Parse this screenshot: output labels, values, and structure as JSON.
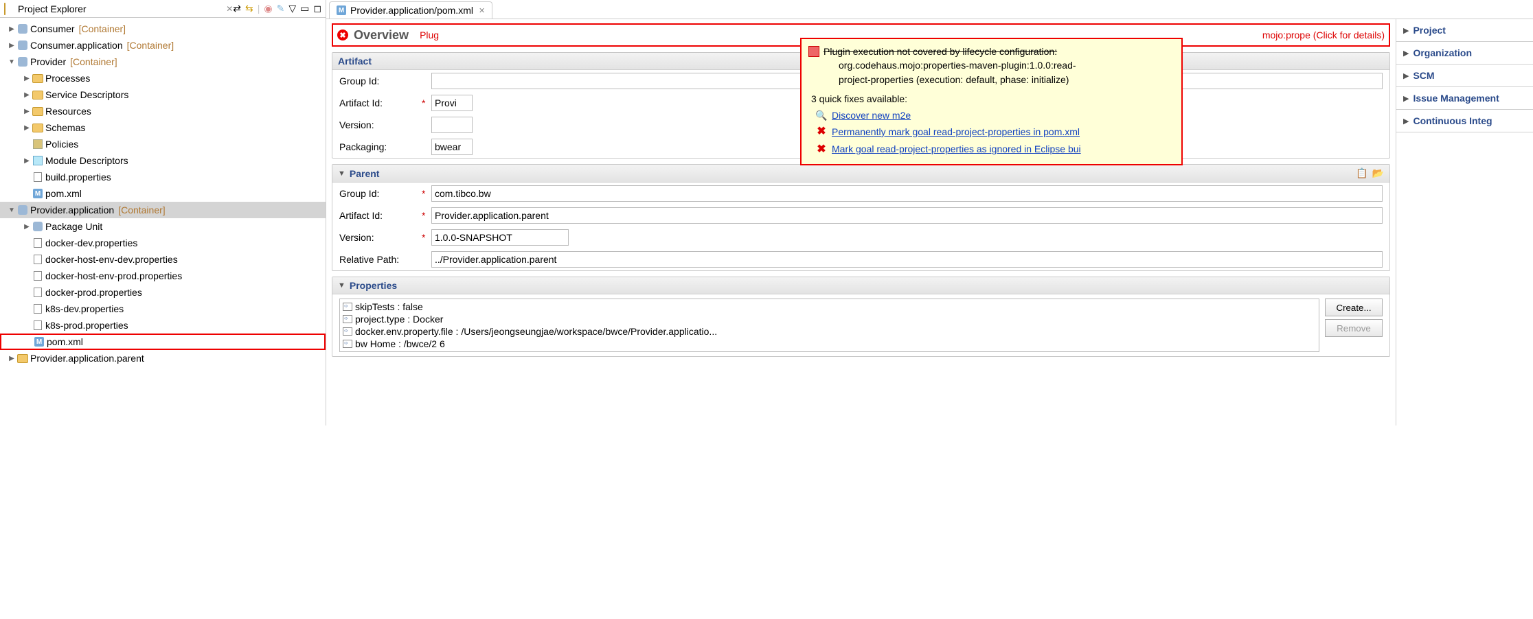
{
  "explorer": {
    "title": "Project Explorer",
    "toolbar_icons": [
      "collapse-all",
      "link-editor",
      "filter",
      "menu",
      "min",
      "max"
    ],
    "tree": [
      {
        "indent": 0,
        "arrow": "▶",
        "icon": "gear",
        "label": "Consumer",
        "suffix": "[Container]"
      },
      {
        "indent": 0,
        "arrow": "▶",
        "icon": "gear",
        "label": "Consumer.application",
        "suffix": "[Container]"
      },
      {
        "indent": 0,
        "arrow": "▼",
        "icon": "gear",
        "label": "Provider",
        "suffix": "[Container]"
      },
      {
        "indent": 1,
        "arrow": "▶",
        "icon": "folder",
        "label": "Processes"
      },
      {
        "indent": 1,
        "arrow": "▶",
        "icon": "folder",
        "label": "Service Descriptors"
      },
      {
        "indent": 1,
        "arrow": "▶",
        "icon": "folder",
        "label": "Resources"
      },
      {
        "indent": 1,
        "arrow": "▶",
        "icon": "folder",
        "label": "Schemas"
      },
      {
        "indent": 1,
        "arrow": "",
        "icon": "pkg",
        "label": "Policies"
      },
      {
        "indent": 1,
        "arrow": "▶",
        "icon": "cube",
        "label": "Module Descriptors"
      },
      {
        "indent": 1,
        "arrow": "",
        "icon": "file",
        "label": "build.properties"
      },
      {
        "indent": 1,
        "arrow": "",
        "icon": "m",
        "label": "pom.xml"
      },
      {
        "indent": 0,
        "arrow": "▼",
        "icon": "gear",
        "label": "Provider.application",
        "suffix": "[Container]",
        "selected": true
      },
      {
        "indent": 1,
        "arrow": "▶",
        "icon": "gear",
        "label": "Package Unit"
      },
      {
        "indent": 1,
        "arrow": "",
        "icon": "file",
        "label": "docker-dev.properties"
      },
      {
        "indent": 1,
        "arrow": "",
        "icon": "file",
        "label": "docker-host-env-dev.properties"
      },
      {
        "indent": 1,
        "arrow": "",
        "icon": "file",
        "label": "docker-host-env-prod.properties"
      },
      {
        "indent": 1,
        "arrow": "",
        "icon": "file",
        "label": "docker-prod.properties"
      },
      {
        "indent": 1,
        "arrow": "",
        "icon": "file",
        "label": "k8s-dev.properties"
      },
      {
        "indent": 1,
        "arrow": "",
        "icon": "file",
        "label": "k8s-prod.properties"
      },
      {
        "indent": 1,
        "arrow": "",
        "icon": "m",
        "label": "pom.xml",
        "redbox": true
      },
      {
        "indent": 0,
        "arrow": "▶",
        "icon": "folder",
        "label": "Provider.application.parent"
      }
    ]
  },
  "editor": {
    "tab_title": "Provider.application/pom.xml",
    "overview": {
      "title": "Overview",
      "error_msg_left": "Plug",
      "error_msg_right": "mojo:prope (Click for details)"
    },
    "artifact": {
      "title": "Artifact",
      "group_label": "Group Id:",
      "group_value": "",
      "artifact_label": "Artifact Id:",
      "artifact_value": "Provi",
      "version_label": "Version:",
      "version_value": "",
      "packaging_label": "Packaging:",
      "packaging_value": "bwear"
    },
    "parent": {
      "title": "Parent",
      "group_label": "Group Id:",
      "group_value": "com.tibco.bw",
      "artifact_label": "Artifact Id:",
      "artifact_value": "Provider.application.parent",
      "version_label": "Version:",
      "version_value": "1.0.0-SNAPSHOT",
      "relpath_label": "Relative Path:",
      "relpath_value": "../Provider.application.parent"
    },
    "properties": {
      "title": "Properties",
      "items": [
        "skipTests : false",
        "project.type : Docker",
        "docker.env.property.file : /Users/jeongseungjae/workspace/bwce/Provider.applicatio...",
        "bw Home : /bwce/2 6"
      ],
      "create_label": "Create...",
      "remove_label": "Remove"
    },
    "side_sections": [
      "Project",
      "Organization",
      "SCM",
      "Issue Management",
      "Continuous Integ"
    ]
  },
  "tooltip": {
    "line1": "Plugin execution not covered by lifecycle configuration:",
    "line2": "org.codehaus.mojo:properties-maven-plugin:1.0.0:read-",
    "line3": "project-properties (execution: default, phase: initialize)",
    "qf_title": "3 quick fixes available:",
    "fixes": [
      {
        "icon": "search",
        "label": "Discover new m2e"
      },
      {
        "icon": "redx",
        "label": "Permanently mark goal read-project-properties in pom.xml"
      },
      {
        "icon": "redx",
        "label": "Mark goal read-project-properties as ignored in Eclipse bui"
      }
    ]
  }
}
